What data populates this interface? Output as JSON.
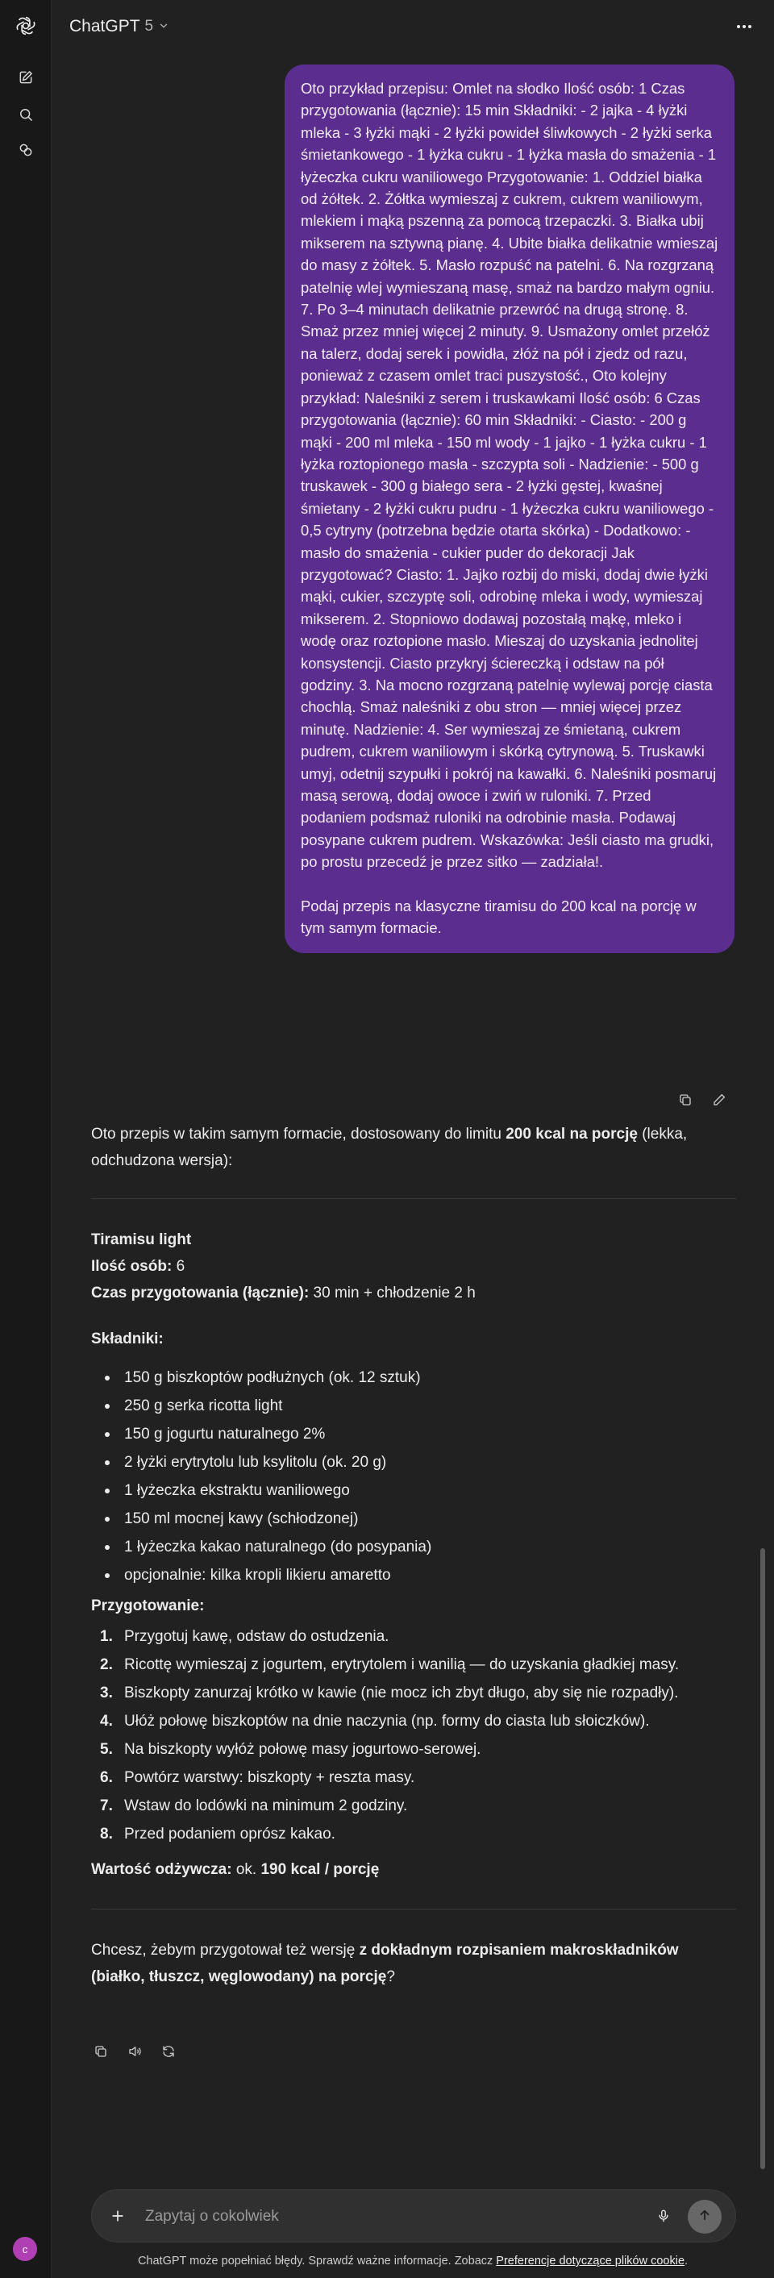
{
  "app": {
    "model_name": "ChatGPT",
    "model_version": "5",
    "avatar_letter": "c"
  },
  "conversation": {
    "user_message": {
      "paragraph_1": "Oto przykład przepisu: Omlet na słodko Ilość osób: 1 Czas przygotowania (łącznie): 15 min Składniki: - 2 jajka - 4 łyżki mleka - 3 łyżki mąki - 2 łyżki powideł śliwkowych - 2 łyżki serka śmietankowego - 1 łyżka cukru - 1 łyżka masła do smażenia - 1 łyżeczka cukru waniliowego Przygotowanie: 1. Oddziel białka od żółtek. 2. Żółtka wymieszaj z cukrem, cukrem waniliowym, mlekiem i mąką pszenną za pomocą trzepaczki. 3. Białka ubij mikserem na sztywną pianę. 4. Ubite białka delikatnie wmieszaj do masy z żółtek. 5. Masło rozpuść na patelni. 6. Na rozgrzaną patelnię wlej wymieszaną masę, smaż na bardzo małym ogniu. 7. Po 3–4 minutach delikatnie przewróć na drugą stronę. 8. Smaż przez mniej więcej 2 minuty. 9. Usmażony omlet przełóż na talerz, dodaj serek i powidła, złóż na pół i zjedz od razu, ponieważ z czasem omlet traci puszystość., Oto kolejny przykład: Naleśniki z serem i truskawkami Ilość osób: 6 Czas przygotowania (łącznie): 60 min Składniki: - Ciasto: - 200 g mąki - 200 ml mleka - 150 ml wody - 1 jajko - 1 łyżka cukru - 1 łyżka roztopionego masła - szczypta soli - Nadzienie: - 500 g truskawek - 300 g białego sera - 2 łyżki gęstej, kwaśnej śmietany - 2 łyżki cukru pudru - 1 łyżeczka cukru waniliowego - 0,5 cytryny (potrzebna będzie otarta skórka) - Dodatkowo: - masło do smażenia - cukier puder do dekoracji Jak przygotować? Ciasto: 1. Jajko rozbij do miski, dodaj dwie łyżki mąki, cukier, szczyptę soli, odrobinę mleka i wody, wymieszaj mikserem. 2. Stopniowo dodawaj pozostałą mąkę, mleko i wodę oraz roztopione masło. Mieszaj do uzyskania jednolitej konsystencji. Ciasto przykryj ściereczką i odstaw na pół godziny. 3. Na mocno rozgrzaną patelnię wylewaj porcję ciasta chochlą. Smaż naleśniki z obu stron — mniej więcej przez minutę. Nadzienie: 4. Ser wymieszaj ze śmietaną, cukrem pudrem, cukrem waniliowym i skórką cytrynową. 5. Truskawki umyj, odetnij szypułki i pokrój na kawałki. 6. Naleśniki posmaruj masą serową, dodaj owoce i zwiń w ruloniki. 7. Przed podaniem podsmaż ruloniki na odrobinie masła. Podawaj posypane cukrem pudrem. Wskazówka: Jeśli ciasto ma grudki, po prostu przecedź je przez sitko — zadziała!.",
      "paragraph_2": "Podaj przepis na klasyczne tiramisu do 200 kcal na porcję w tym samym formacie."
    },
    "answer": {
      "intro_before": "Oto przepis w takim samym formacie, dostosowany do limitu ",
      "intro_bold": "200 kcal na porcję",
      "intro_after": " (lekka, odchudzona wersja):",
      "title": "Tiramisu light",
      "servings_label": "Ilość osób:",
      "servings_value": " 6",
      "time_label": "Czas przygotowania (łącznie):",
      "time_value": " 30 min + chłodzenie 2 h",
      "ingredients_label": "Składniki:",
      "ingredients": [
        "150 g biszkoptów podłużnych (ok. 12 sztuk)",
        "250 g serka ricotta light",
        "150 g jogurtu naturalnego 2%",
        "2 łyżki erytrytolu lub ksylitolu (ok. 20 g)",
        "1 łyżeczka ekstraktu waniliowego",
        "150 ml mocnej kawy (schłodzonej)",
        "1 łyżeczka kakao naturalnego (do posypania)",
        "opcjonalnie: kilka kropli likieru amaretto"
      ],
      "steps_label": "Przygotowanie:",
      "steps": [
        {
          "num": "1.",
          "text": "Przygotuj kawę, odstaw do ostudzenia."
        },
        {
          "num": "2.",
          "text": "Ricottę wymieszaj z jogurtem, erytrytolem i wanilią — do uzyskania gładkiej masy."
        },
        {
          "num": "3.",
          "text": "Biszkopty zanurzaj krótko w kawie (nie mocz ich zbyt długo, aby się nie rozpadły)."
        },
        {
          "num": "4.",
          "text": "Ułóż połowę biszkoptów na dnie naczynia (np. formy do ciasta lub słoiczków)."
        },
        {
          "num": "5.",
          "text": "Na biszkopty wyłóż połowę masy jogurtowo-serowej."
        },
        {
          "num": "6.",
          "text": "Powtórz warstwy: biszkopty + reszta masy."
        },
        {
          "num": "7.",
          "text": "Wstaw do lodówki na minimum 2 godziny."
        },
        {
          "num": "8.",
          "text": "Przed podaniem oprósz kakao."
        }
      ],
      "nutrition_label": "Wartość odżywcza:",
      "nutrition_plain": " ok. ",
      "nutrition_bold": "190 kcal / porcję",
      "followup_before": "Chcesz, żebym przygotował też wersję ",
      "followup_bold": "z dokładnym rozpisaniem makroskładników (białko, tłuszcz, węglowodany) na porcję",
      "followup_after": "?"
    }
  },
  "composer": {
    "placeholder": "Zapytaj o cokolwiek"
  },
  "footer": {
    "text": "ChatGPT może popełniać błędy. Sprawdź ważne informacje. Zobacz ",
    "link": "Preferencje dotyczące plików cookie",
    "end": "."
  }
}
